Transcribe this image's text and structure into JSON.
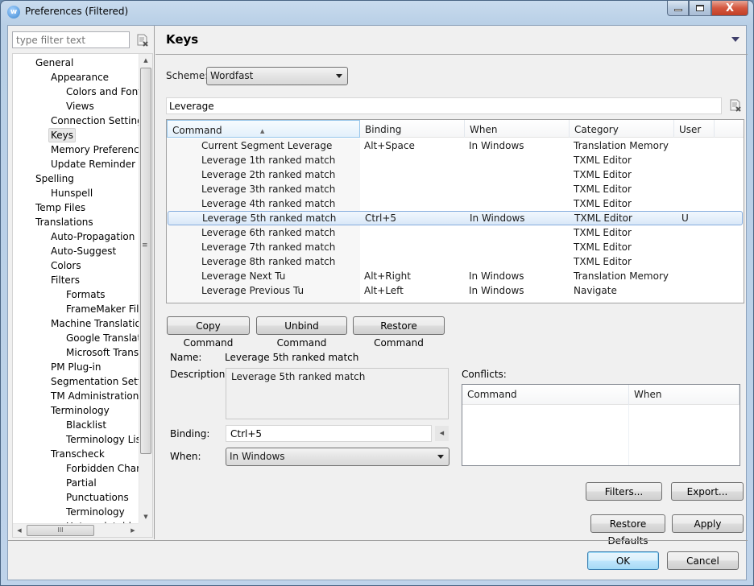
{
  "window": {
    "title": "Preferences (Filtered)",
    "app_icon": "wordfast-logo-icon",
    "controls": {
      "minimize": "minimize-icon",
      "maximize": "maximize-icon",
      "close": "close-icon",
      "close_glyph": "X"
    }
  },
  "left": {
    "filter_placeholder": "type filter text",
    "filter_value": "",
    "clear_icon": "clear-filter-icon",
    "tree": [
      {
        "label": "General",
        "level": 0
      },
      {
        "label": "Appearance",
        "level": 1
      },
      {
        "label": "Colors and Fonts",
        "level": 2
      },
      {
        "label": "Views",
        "level": 2
      },
      {
        "label": "Connection Settings",
        "level": 1
      },
      {
        "label": "Keys",
        "level": 1,
        "selected": true
      },
      {
        "label": "Memory Preferences",
        "level": 1
      },
      {
        "label": "Update Reminder",
        "level": 1
      },
      {
        "label": "Spelling",
        "level": 0
      },
      {
        "label": "Hunspell",
        "level": 1
      },
      {
        "label": "Temp Files",
        "level": 0
      },
      {
        "label": "Translations",
        "level": 0
      },
      {
        "label": "Auto-Propagation",
        "level": 1
      },
      {
        "label": "Auto-Suggest",
        "level": 1
      },
      {
        "label": "Colors",
        "level": 1
      },
      {
        "label": "Filters",
        "level": 1
      },
      {
        "label": "Formats",
        "level": 2
      },
      {
        "label": "FrameMaker Filter",
        "level": 2
      },
      {
        "label": "Machine Translation",
        "level": 1
      },
      {
        "label": "Google Translate",
        "level": 2
      },
      {
        "label": "Microsoft Translator",
        "level": 2
      },
      {
        "label": "PM Plug-in",
        "level": 1
      },
      {
        "label": "Segmentation Settings",
        "level": 1
      },
      {
        "label": "TM Administration",
        "level": 1
      },
      {
        "label": "Terminology",
        "level": 1
      },
      {
        "label": "Blacklist",
        "level": 2
      },
      {
        "label": "Terminology List",
        "level": 2
      },
      {
        "label": "Transcheck",
        "level": 1
      },
      {
        "label": "Forbidden Chars",
        "level": 2
      },
      {
        "label": "Partial",
        "level": 2
      },
      {
        "label": "Punctuations",
        "level": 2
      },
      {
        "label": "Terminology",
        "level": 2
      },
      {
        "label": "Untranslatable",
        "level": 2
      }
    ],
    "scroll": {
      "up": "▲",
      "down": "▼",
      "left": "◀",
      "right": "▶",
      "grip_v": "≡",
      "grip_h": "III"
    }
  },
  "page": {
    "title": "Keys",
    "view_menu_icon": "view-menu-icon",
    "scheme_label": "Scheme:",
    "scheme_value": "Wordfast",
    "filter_value": "Leverage",
    "table": {
      "headers": [
        "Command",
        "Binding",
        "When",
        "Category",
        "User"
      ],
      "sort_arrow": "▲",
      "rows": [
        {
          "command": "Current Segment Leverage",
          "binding": "Alt+Space",
          "when": "In Windows",
          "category": "Translation Memory",
          "user": ""
        },
        {
          "command": "Leverage 1th ranked match",
          "binding": "",
          "when": "",
          "category": "TXML Editor",
          "user": ""
        },
        {
          "command": "Leverage 2th ranked match",
          "binding": "",
          "when": "",
          "category": "TXML Editor",
          "user": ""
        },
        {
          "command": "Leverage 3th ranked match",
          "binding": "",
          "when": "",
          "category": "TXML Editor",
          "user": ""
        },
        {
          "command": "Leverage 4th ranked match",
          "binding": "",
          "when": "",
          "category": "TXML Editor",
          "user": ""
        },
        {
          "command": "Leverage 5th ranked match",
          "binding": "Ctrl+5",
          "when": "In Windows",
          "category": "TXML Editor",
          "user": "U",
          "selected": true
        },
        {
          "command": "Leverage 6th ranked match",
          "binding": "",
          "when": "",
          "category": "TXML Editor",
          "user": ""
        },
        {
          "command": "Leverage 7th ranked match",
          "binding": "",
          "when": "",
          "category": "TXML Editor",
          "user": ""
        },
        {
          "command": "Leverage 8th ranked match",
          "binding": "",
          "when": "",
          "category": "TXML Editor",
          "user": ""
        },
        {
          "command": "Leverage Next Tu",
          "binding": "Alt+Right",
          "when": "In Windows",
          "category": "Translation Memory",
          "user": ""
        },
        {
          "command": "Leverage Previous Tu",
          "binding": "Alt+Left",
          "when": "In Windows",
          "category": "Navigate",
          "user": ""
        }
      ]
    },
    "buttons": {
      "copy": "Copy Command",
      "unbind": "Unbind Command",
      "restore": "Restore Command"
    },
    "details": {
      "name_label": "Name:",
      "name_value": "Leverage 5th ranked match",
      "description_label": "Description:",
      "description_value": "Leverage 5th ranked match",
      "binding_label": "Binding:",
      "binding_value": "Ctrl+5",
      "binding_menu_glyph": "◀",
      "when_label": "When:",
      "when_value": "In Windows"
    },
    "conflicts": {
      "label": "Conflicts:",
      "headers": [
        "Command",
        "When"
      ]
    },
    "filters_button": "Filters...",
    "export_button": "Export...",
    "restore_defaults_button": "Restore Defaults",
    "apply_button": "Apply"
  },
  "footer": {
    "ok": "OK",
    "cancel": "Cancel"
  }
}
